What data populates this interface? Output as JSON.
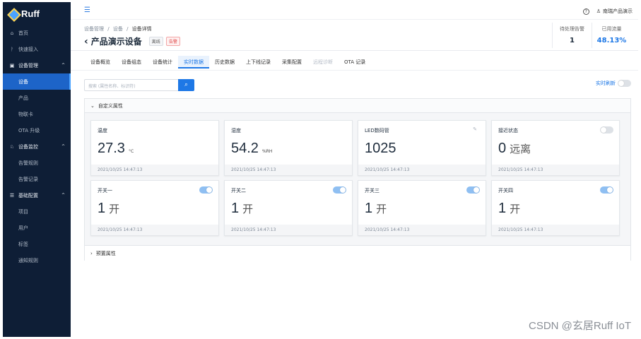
{
  "brand": "Ruff",
  "sidebar": {
    "items": [
      {
        "label": "首页",
        "icon": "⌂",
        "type": "item"
      },
      {
        "label": "快速接入",
        "icon": "ᚹ",
        "type": "item"
      },
      {
        "label": "设备管理",
        "icon": "▣",
        "type": "group",
        "chev": "^"
      },
      {
        "label": "设备",
        "type": "sub",
        "active": true
      },
      {
        "label": "产品",
        "type": "sub"
      },
      {
        "label": "物联卡",
        "type": "sub"
      },
      {
        "label": "OTA 升级",
        "type": "sub"
      },
      {
        "label": "设备监控",
        "icon": "♘",
        "type": "group",
        "chev": "^"
      },
      {
        "label": "告警规则",
        "type": "sub"
      },
      {
        "label": "告警记录",
        "type": "sub"
      },
      {
        "label": "基础配置",
        "icon": "☰",
        "type": "group",
        "chev": "^"
      },
      {
        "label": "项目",
        "type": "sub"
      },
      {
        "label": "用户",
        "type": "sub"
      },
      {
        "label": "标签",
        "type": "sub"
      },
      {
        "label": "通知规则",
        "type": "sub"
      }
    ]
  },
  "topbar": {
    "help_icon": "?",
    "user_label": "南瑞产品演示"
  },
  "header": {
    "crumbs": [
      "设备管理",
      "设备",
      "设备详情"
    ],
    "sep": "/",
    "title": "产品演示设备",
    "tag_offline": "离线",
    "tag_alarm": "告警",
    "stat_pending_label": "待处理告警",
    "stat_pending_value": "1",
    "stat_flow_label": "已用流量",
    "stat_flow_value": "48.13%"
  },
  "tabs": [
    "设备概览",
    "设备组态",
    "设备统计",
    "实时数据",
    "历史数据",
    "上下线记录",
    "采集配置",
    "远程诊断",
    "OTA 记录"
  ],
  "search": {
    "placeholder": "搜索 (属性名称、标识符)",
    "button_icon": "⌕"
  },
  "refresh_label": "实时刷新",
  "panel": {
    "custom_title": "自定义属性",
    "preset_title": "预置属性"
  },
  "cards": [
    {
      "name": "温度",
      "value": "27.3",
      "unit": "°C",
      "time": "2021/10/25 14:47:13",
      "control": "none"
    },
    {
      "name": "湿度",
      "value": "54.2",
      "unit": "%RH",
      "time": "2021/10/25 14:47:13",
      "control": "none"
    },
    {
      "name": "LED数码管",
      "value": "1025",
      "unit": "",
      "time": "2021/10/25 14:47:13",
      "control": "edit"
    },
    {
      "name": "接近状态",
      "value": "0",
      "text": "远离",
      "time": "2021/10/25 14:47:13",
      "control": "toggle-off"
    },
    {
      "name": "开关一",
      "value": "1",
      "text": "开",
      "time": "2021/10/25 14:47:13",
      "control": "toggle-on"
    },
    {
      "name": "开关二",
      "value": "1",
      "text": "开",
      "time": "2021/10/25 14:47:13",
      "control": "toggle-on"
    },
    {
      "name": "开关三",
      "value": "1",
      "text": "开",
      "time": "2021/10/25 14:47:13",
      "control": "toggle-on"
    },
    {
      "name": "开关四",
      "value": "1",
      "text": "开",
      "time": "2021/10/25 14:47:13",
      "control": "toggle-on"
    }
  ],
  "watermark": "CSDN @玄居Ruff IoT",
  "colors": {
    "accent": "#1e78e6",
    "sidebar": "#0e1e36",
    "active": "#1d64c8"
  }
}
